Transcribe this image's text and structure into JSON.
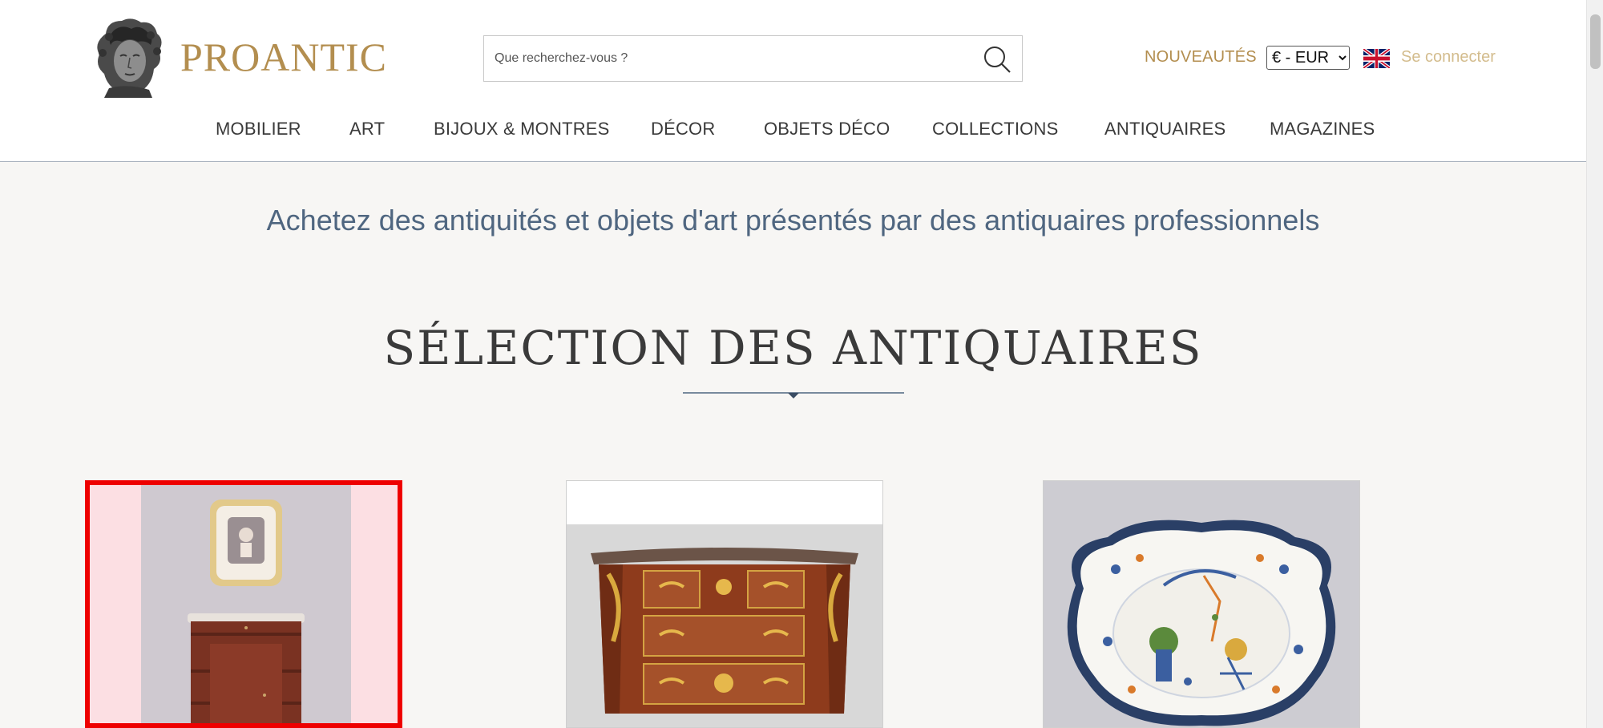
{
  "header": {
    "logo_text": "PROANTIC",
    "search_placeholder": "Que recherchez-vous ?",
    "nouveautes": "NOUVEAUTÉS",
    "currency_selected": "€ - EUR",
    "connect": "Se connecter"
  },
  "nav": [
    "MOBILIER",
    "ART",
    "BIJOUX & MONTRES",
    "DÉCOR",
    "OBJETS DÉCO",
    "COLLECTIONS",
    "ANTIQUAIRES",
    "MAGAZINES"
  ],
  "main": {
    "tagline": "Achetez des antiquités et objets d'art présentés par des antiquaires professionnels",
    "section_title": "SÉLECTION DES ANTIQUAIRES"
  },
  "cards": [
    {
      "icon": "cabinet-with-mirror-image",
      "selected": true
    },
    {
      "icon": "louis-xv-commode-image",
      "selected": false
    },
    {
      "icon": "faience-platter-image",
      "selected": false
    }
  ],
  "colors": {
    "brand_gold": "#b38e4f",
    "connect_gold": "#d3bc8d",
    "tagline_blue": "#4f6680",
    "highlight_red": "#ee0000",
    "page_bg": "#f7f6f4"
  }
}
